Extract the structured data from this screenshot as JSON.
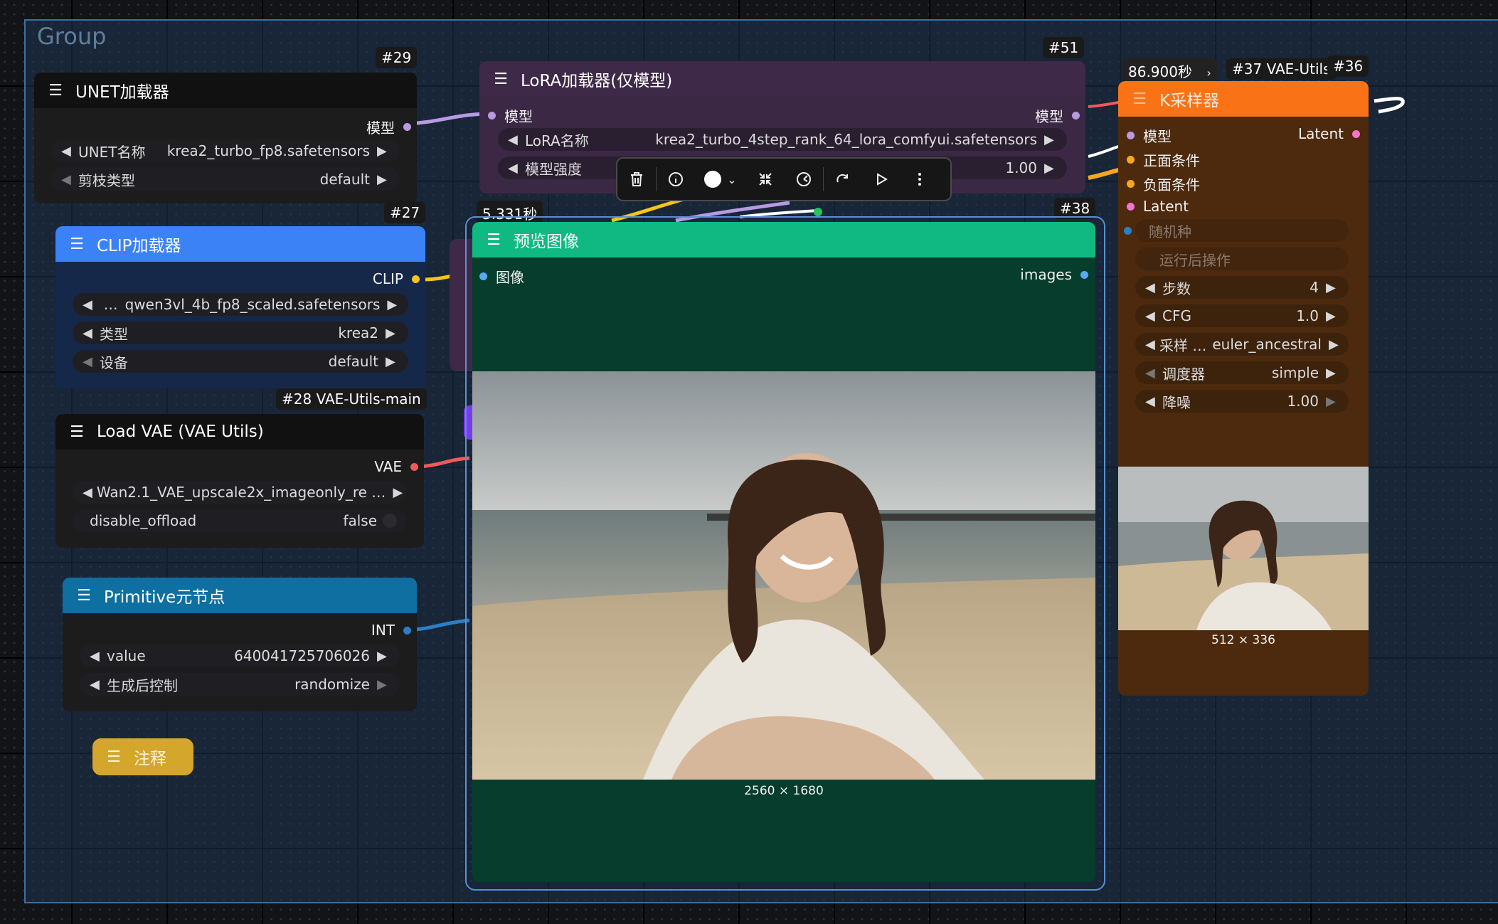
{
  "group": {
    "title": "Group"
  },
  "badges": {
    "unet": "#29",
    "lora": "#51",
    "clip": "#27",
    "vae": "#28 VAE-Utils-main",
    "preview_time": "5.331秒",
    "preview_id": "#38",
    "ksampler_time": "86.900秒",
    "ksampler_chevron": "›",
    "ksampler_tag": "#37 VAE-Utils",
    "ksampler_id": "#36"
  },
  "unet": {
    "title": "UNET加载器",
    "output": "模型",
    "widgets": [
      {
        "label": "UNET名称",
        "value": "krea2_turbo_fp8.safetensors"
      },
      {
        "label": "剪枝类型",
        "value": "default"
      }
    ]
  },
  "clip": {
    "title": "CLIP加载器",
    "output": "CLIP",
    "widgets": [
      {
        "label": "…",
        "value": "qwen3vl_4b_fp8_scaled.safetensors"
      },
      {
        "label": "类型",
        "value": "krea2"
      },
      {
        "label": "设备",
        "value": "default"
      }
    ]
  },
  "vae": {
    "title": "Load VAE (VAE Utils)",
    "output": "VAE",
    "widgets": [
      {
        "label": "Wan2.1_VAE_upscale2x_imageonly_re …",
        "value": ""
      },
      {
        "label": "disable_offload",
        "value": "false"
      }
    ]
  },
  "primitive": {
    "title": "Primitive元节点",
    "output": "INT",
    "widgets": [
      {
        "label": "value",
        "value": "640041725706026"
      },
      {
        "label": "生成后控制",
        "value": "randomize"
      }
    ]
  },
  "note": {
    "title": "注释"
  },
  "lora": {
    "title": "LoRA加载器(仅模型)",
    "input": "模型",
    "output": "模型",
    "widgets": [
      {
        "label": "LoRA名称",
        "value": "krea2_turbo_4step_rank_64_lora_comfyui.safetensors"
      },
      {
        "label": "模型强度",
        "value": "1.00"
      }
    ]
  },
  "toolbar": {
    "icons": [
      "trash-icon",
      "info-icon",
      "color-circle-icon",
      "chevron-down-icon",
      "collapse-icon",
      "bypass-icon",
      "redo-icon",
      "play-icon",
      "more-icon"
    ]
  },
  "preview": {
    "title": "预览图像",
    "input": "图像",
    "output": "images",
    "image_size": "2560 × 1680"
  },
  "ksampler": {
    "title": "K采样器",
    "inputs": [
      "模型",
      "正面条件",
      "负面条件",
      "Latent"
    ],
    "output": "Latent",
    "disabled_widgets": [
      "随机种",
      "运行后操作"
    ],
    "widgets": [
      {
        "label": "步数",
        "value": "4"
      },
      {
        "label": "CFG",
        "value": "1.0"
      },
      {
        "label": "采样 …",
        "value": "euler_ancestral"
      },
      {
        "label": "调度器",
        "value": "simple"
      },
      {
        "label": "降噪",
        "value": "1.00"
      }
    ],
    "image_size": "512 × 336"
  },
  "colors": {
    "unet_header": "#1c1c1c",
    "clip_header": "#3b82f6",
    "lora_header": "#3e2a48",
    "preview_header": "#10b981",
    "primitive_header": "#0e6fa0",
    "ksampler_header": "#f97316",
    "note": "#d4a72c"
  }
}
